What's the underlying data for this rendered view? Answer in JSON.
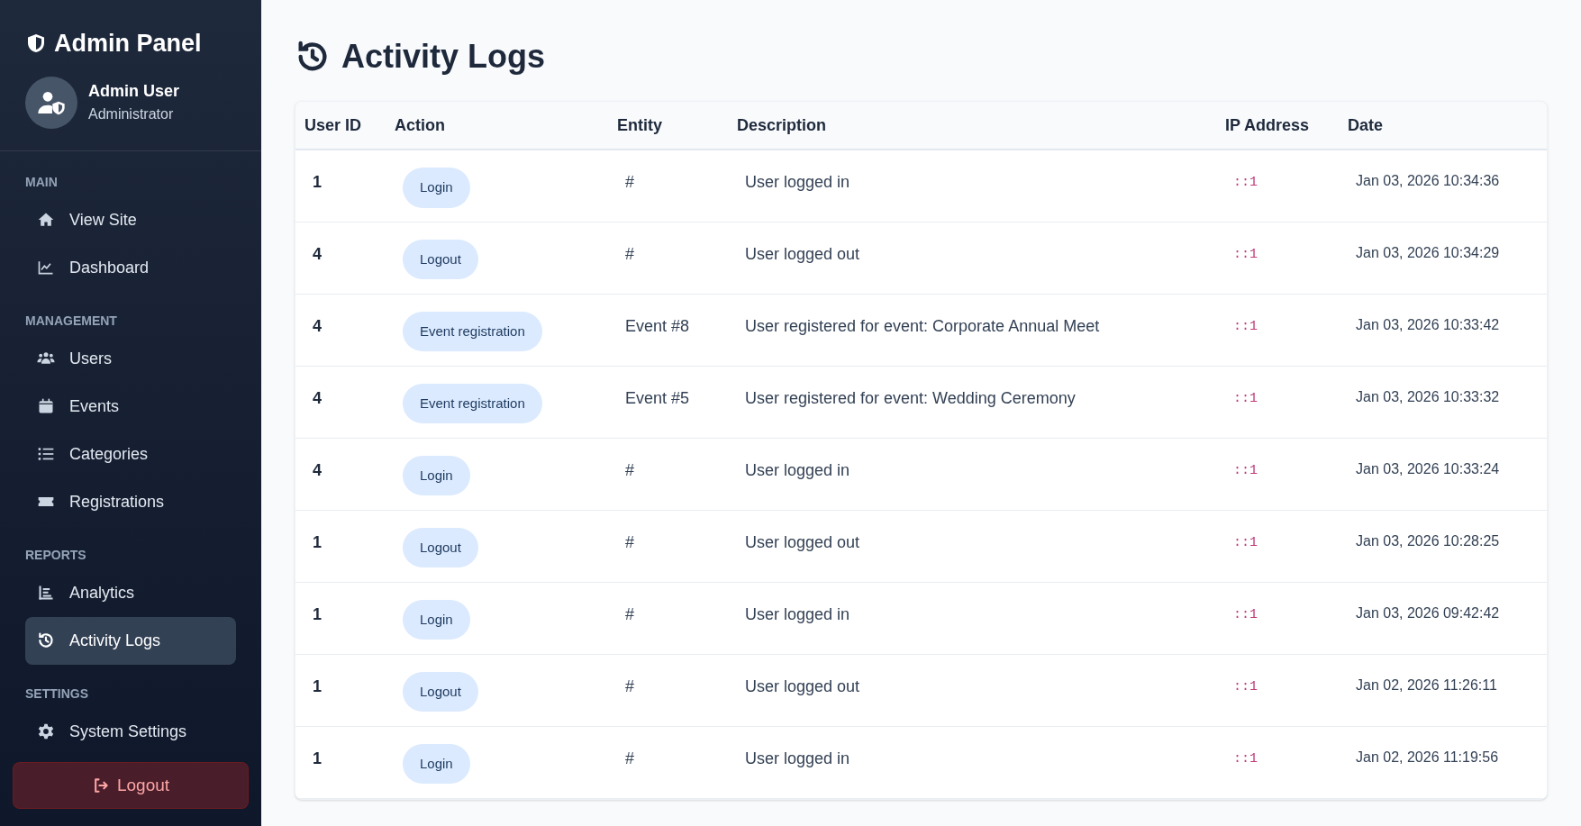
{
  "sidebar": {
    "title": "Admin Panel",
    "user": {
      "name": "Admin User",
      "role": "Administrator"
    },
    "sections": [
      {
        "title": "MAIN",
        "items": [
          {
            "label": "View Site",
            "selected": false
          },
          {
            "label": "Dashboard",
            "selected": false
          }
        ]
      },
      {
        "title": "MANAGEMENT",
        "items": [
          {
            "label": "Users",
            "selected": false
          },
          {
            "label": "Events",
            "selected": false
          },
          {
            "label": "Categories",
            "selected": false
          },
          {
            "label": "Registrations",
            "selected": false
          }
        ]
      },
      {
        "title": "REPORTS",
        "items": [
          {
            "label": "Analytics",
            "selected": false
          },
          {
            "label": "Activity Logs",
            "selected": true
          }
        ]
      },
      {
        "title": "SETTINGS",
        "items": [
          {
            "label": "System Settings",
            "selected": false
          }
        ]
      }
    ],
    "logout": "Logout"
  },
  "page": {
    "title": "Activity Logs"
  },
  "table": {
    "columns": [
      "User ID",
      "Action",
      "Entity",
      "Description",
      "IP Address",
      "Date"
    ],
    "rows": [
      {
        "user_id": "1",
        "action": "Login",
        "entity": "#",
        "description": "User logged in",
        "ip": "::1",
        "date": "Jan 03, 2026 10:34:36"
      },
      {
        "user_id": "4",
        "action": "Logout",
        "entity": "#",
        "description": "User logged out",
        "ip": "::1",
        "date": "Jan 03, 2026 10:34:29"
      },
      {
        "user_id": "4",
        "action": "Event registration",
        "entity": "Event #8",
        "description": "User registered for event: Corporate Annual Meet",
        "ip": "::1",
        "date": "Jan 03, 2026 10:33:42"
      },
      {
        "user_id": "4",
        "action": "Event registration",
        "entity": "Event #5",
        "description": "User registered for event: Wedding Ceremony",
        "ip": "::1",
        "date": "Jan 03, 2026 10:33:32"
      },
      {
        "user_id": "4",
        "action": "Login",
        "entity": "#",
        "description": "User logged in",
        "ip": "::1",
        "date": "Jan 03, 2026 10:33:24"
      },
      {
        "user_id": "1",
        "action": "Logout",
        "entity": "#",
        "description": "User logged out",
        "ip": "::1",
        "date": "Jan 03, 2026 10:28:25"
      },
      {
        "user_id": "1",
        "action": "Login",
        "entity": "#",
        "description": "User logged in",
        "ip": "::1",
        "date": "Jan 03, 2026 09:42:42"
      },
      {
        "user_id": "1",
        "action": "Logout",
        "entity": "#",
        "description": "User logged out",
        "ip": "::1",
        "date": "Jan 02, 2026 11:26:11"
      },
      {
        "user_id": "1",
        "action": "Login",
        "entity": "#",
        "description": "User logged in",
        "ip": "::1",
        "date": "Jan 02, 2026 11:19:56"
      }
    ]
  }
}
